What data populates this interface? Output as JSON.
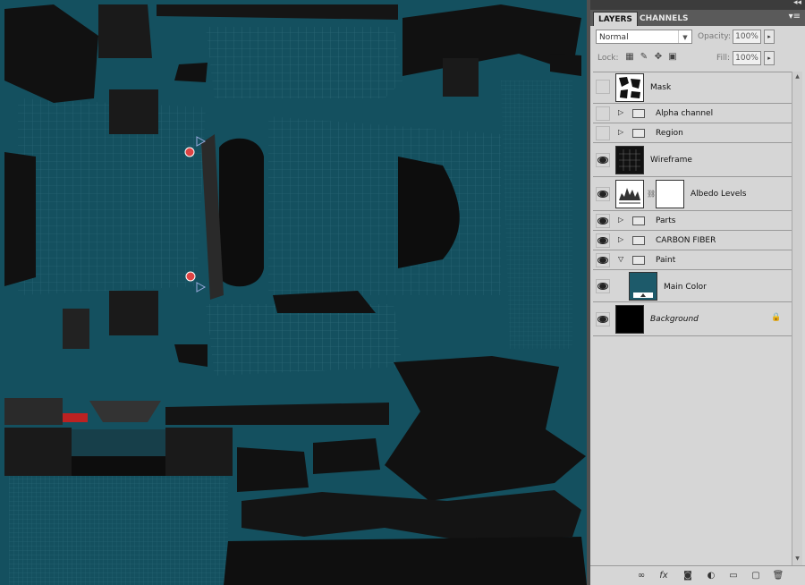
{
  "panel": {
    "collapse_label": "◂◂",
    "tabs": [
      {
        "label": "LAYERS",
        "active": true
      },
      {
        "label": "CHANNELS",
        "active": false
      }
    ],
    "menu_icon": "panel-menu-icon",
    "blend_mode": "Normal",
    "opacity_label": "Opacity:",
    "opacity_value": "100%",
    "lock_label": "Lock:",
    "fill_label": "Fill:",
    "fill_value": "100%"
  },
  "layers": [
    {
      "name": "Mask",
      "type": "layer",
      "visible": false,
      "thumb": "mask"
    },
    {
      "name": "Alpha channel",
      "type": "group",
      "visible": false,
      "expanded": false
    },
    {
      "name": "Region",
      "type": "group",
      "visible": false,
      "expanded": false
    },
    {
      "name": "Wireframe",
      "type": "layer",
      "visible": true,
      "thumb": "wire"
    },
    {
      "name": "Albedo Levels",
      "type": "adjustment",
      "visible": true
    },
    {
      "name": "Parts",
      "type": "group",
      "visible": true,
      "expanded": false
    },
    {
      "name": "CARBON FIBER",
      "type": "group",
      "visible": true,
      "expanded": false
    },
    {
      "name": "Paint",
      "type": "group",
      "visible": true,
      "expanded": true
    },
    {
      "name": "Main Color",
      "type": "layer",
      "visible": true,
      "thumb": "teal"
    },
    {
      "name": "Background",
      "type": "background",
      "visible": true,
      "locked": true
    }
  ],
  "colors": {
    "canvas": "#14505f",
    "panel": "#d6d6d6",
    "teal_thumb": "#1d5a6a"
  },
  "bottom_icons": [
    "link-icon",
    "fx-icon",
    "mask-icon",
    "adjustment-icon",
    "new-group-icon",
    "new-layer-icon",
    "trash-icon"
  ],
  "fx_label": "fx"
}
